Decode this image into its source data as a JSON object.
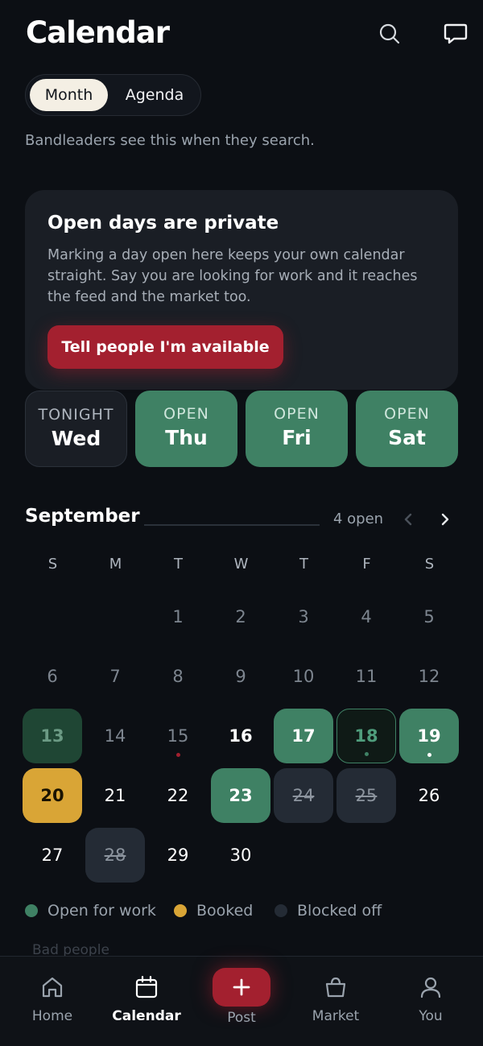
{
  "header": {
    "title": "Calendar",
    "search_icon": "search-icon",
    "chat_icon": "chat-bubble-icon"
  },
  "view_toggle": {
    "month": "Month",
    "agenda": "Agenda",
    "selected": "Month"
  },
  "subtitle": "Bandleaders see this when they search.",
  "privacy_card": {
    "title": "Open days are private",
    "body": "Marking a day open here keeps your own calendar straight. Say you are looking for work and it reaches the feed and the market too.",
    "cta": "Tell people I'm available"
  },
  "quick_days": [
    {
      "label": "TONIGHT",
      "day": "Wed",
      "state": "tonight"
    },
    {
      "label": "OPEN",
      "day": "Thu",
      "state": "open"
    },
    {
      "label": "OPEN",
      "day": "Fri",
      "state": "open"
    },
    {
      "label": "OPEN",
      "day": "Sat",
      "state": "open"
    }
  ],
  "calendar": {
    "month": "September",
    "open_count": "4 open",
    "weekdays": [
      "S",
      "M",
      "T",
      "W",
      "T",
      "F",
      "S"
    ],
    "days": [
      {
        "n": "1",
        "state": "plain"
      },
      {
        "n": "2",
        "state": "plain"
      },
      {
        "n": "3",
        "state": "plain"
      },
      {
        "n": "4",
        "state": "plain"
      },
      {
        "n": "5",
        "state": "plain"
      },
      {
        "n": "6",
        "state": "plain"
      },
      {
        "n": "7",
        "state": "plain"
      },
      {
        "n": "8",
        "state": "plain"
      },
      {
        "n": "9",
        "state": "plain"
      },
      {
        "n": "10",
        "state": "plain"
      },
      {
        "n": "11",
        "state": "plain"
      },
      {
        "n": "12",
        "state": "plain"
      },
      {
        "n": "13",
        "state": "past-open"
      },
      {
        "n": "14",
        "state": "plain"
      },
      {
        "n": "15",
        "state": "plain",
        "dot": "#a3202f"
      },
      {
        "n": "16",
        "state": "today"
      },
      {
        "n": "17",
        "state": "open"
      },
      {
        "n": "18",
        "state": "open-outline",
        "dot": "#3f8164"
      },
      {
        "n": "19",
        "state": "open",
        "dot": "#ffffff"
      },
      {
        "n": "20",
        "state": "booked"
      },
      {
        "n": "21",
        "state": "strong"
      },
      {
        "n": "22",
        "state": "strong"
      },
      {
        "n": "23",
        "state": "open"
      },
      {
        "n": "24",
        "state": "blocked"
      },
      {
        "n": "25",
        "state": "blocked"
      },
      {
        "n": "26",
        "state": "strong"
      },
      {
        "n": "27",
        "state": "strong"
      },
      {
        "n": "28",
        "state": "blocked"
      },
      {
        "n": "29",
        "state": "strong"
      },
      {
        "n": "30",
        "state": "strong"
      }
    ],
    "first_weekday_index": 2
  },
  "legend": [
    {
      "label": "Open for work",
      "color": "#3f8164"
    },
    {
      "label": "Booked",
      "color": "#d9a536"
    },
    {
      "label": "Blocked off",
      "color": "#242b35"
    }
  ],
  "faded_text": "Bad people",
  "tabbar": {
    "home": "Home",
    "calendar": "Calendar",
    "post": "Post",
    "market": "Market",
    "you": "You",
    "active": "Calendar"
  },
  "colors": {
    "background": "#0c0f14",
    "accent_red": "#a3202f",
    "open_green": "#3f8164",
    "booked_gold": "#d9a536"
  }
}
